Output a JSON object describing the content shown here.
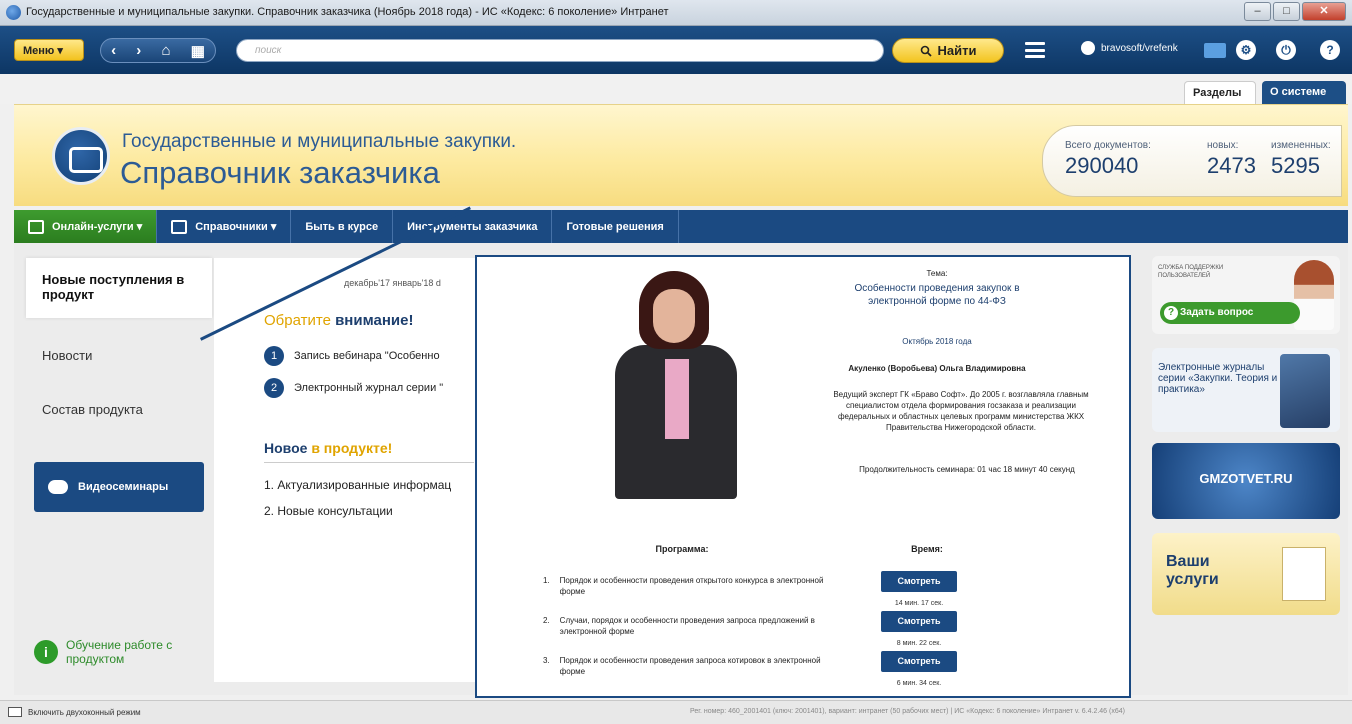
{
  "window": {
    "title": "Государственные и муниципальные закупки. Справочник заказчика (Ноябрь 2018 года) - ИС «Кодекс: 6 поколение» Интранет",
    "minimize": "–",
    "maximize": "□",
    "close": "✕"
  },
  "toolbar": {
    "menu_label": "Меню ▾",
    "back": "‹",
    "forward": "›",
    "home": "⌂",
    "grid": "▦",
    "search_placeholder": "поиск",
    "find_label": "Найти",
    "find_icon": "search-icon",
    "user_name": "bravosoft/vrefenk",
    "settings_glyph": "⚙",
    "power_glyph": "⏻",
    "help_glyph": "?"
  },
  "tabs": {
    "sections": "Разделы",
    "about": "О системе"
  },
  "banner": {
    "subtitle": "Государственные и муниципальные закупки.",
    "title": "Справочник заказчика",
    "stats": [
      {
        "label": "Всего документов:",
        "value": "290040"
      },
      {
        "label": "новых:",
        "value": "2473"
      },
      {
        "label": "измененных:",
        "value": "5295"
      }
    ]
  },
  "nav": [
    {
      "label": "Онлайн-услуги ▾"
    },
    {
      "label": "Справочники ▾"
    },
    {
      "label": "Быть в курсе"
    },
    {
      "label": "Инструменты заказчика"
    },
    {
      "label": "Готовые решения"
    }
  ],
  "sidebar": {
    "active": "Новые поступления в продукт",
    "items": [
      "Новости",
      "Состав продукта"
    ],
    "video": "Видеосеминары",
    "learn": "Обучение работе с продуктом"
  },
  "center": {
    "dates": "декабрь'17  январь'18  d",
    "attention_a": "Обратите ",
    "attention_b": "внимание!",
    "items": [
      {
        "num": "1",
        "text": "Запись вебинара \"Особенно"
      },
      {
        "num": "2",
        "text": "Электронный журнал серии \""
      }
    ],
    "new_a": "Новое ",
    "new_b": "в продукте!",
    "new_items": [
      "1.   Актуализированные информац",
      "2.   Новые консультации"
    ]
  },
  "popup": {
    "theme_label": "Тема:",
    "theme": "Особенности проведения закупок в электронной форме по 44-ФЗ",
    "date": "Октябрь 2018 года",
    "author": "Акуленко (Воробьева) Ольга Владимировна",
    "bio": "Ведущий эксперт ГК «Браво Софт». До 2005 г. возглавляла главным специалистом отдела формирования госзаказа и реализации федеральных и областных целевых программ министерства ЖКХ Правительства Нижегородской области.",
    "duration": "Продолжительность семинара: 01 час 18 минут 40 секунд",
    "program_label": "Программа:",
    "time_label": "Время:",
    "topics": [
      {
        "num": "1.",
        "text": "Порядок и особенности проведения открытого конкурса в электронной форме",
        "button": "Смотреть",
        "time": "14 мин. 17 сек."
      },
      {
        "num": "2.",
        "text": "Случаи, порядок и особенности проведения запроса предложений в электронной форме",
        "button": "Смотреть",
        "time": "8 мин. 22 сек."
      },
      {
        "num": "3.",
        "text": "Порядок и особенности проведения запроса котировок в электронной форме",
        "button": "Смотреть",
        "time": "6 мин. 34 сек."
      }
    ]
  },
  "rightbar": {
    "support_small": "СЛУЖБА ПОДДЕРЖКИ ПОЛЬЗОВАТЕЛЕЙ",
    "ask": "Задать вопрос",
    "journals": "Электронные журналы серии «Закупки. Теория и практика»",
    "gmz": "GMZOTVET.RU",
    "services": "Ваши услуги"
  },
  "statusbar": {
    "left": "Включить двухоконный режим",
    "right": "Рег. номер: 460_2001401 (ключ: 2001401), вариант: интранет (50 рабочих мест)  |  ИС «Кодекс: 6 поколение» Интранет v. 6.4.2.46 (x64)"
  }
}
